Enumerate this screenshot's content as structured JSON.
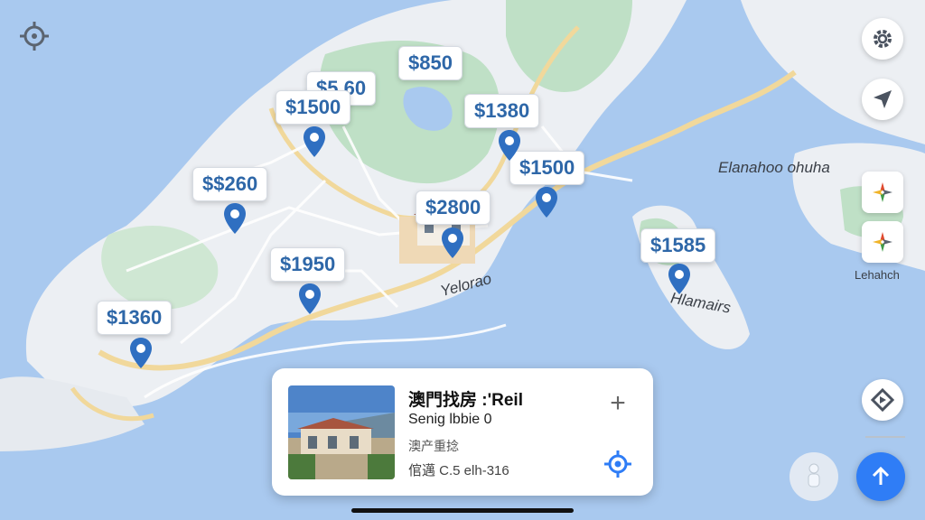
{
  "price_tags": [
    {
      "label": "$850"
    },
    {
      "label": "$5.60"
    },
    {
      "label": "$1500"
    },
    {
      "label": "$1380"
    },
    {
      "label": "$1500"
    },
    {
      "label": "$$260"
    },
    {
      "label": "$2800"
    },
    {
      "label": "$1585"
    },
    {
      "label": "$1950"
    },
    {
      "label": "$1360"
    }
  ],
  "map_labels": {
    "district_east": "Elanahoo ohuha",
    "district_center": "Yelorao",
    "island": "Hlamairs",
    "side_label": "Lehahch"
  },
  "listing_card": {
    "title": "澳門找房 :'Reil",
    "subtitle": "Senig lbbie 0",
    "category": "澳产重捻",
    "detail": "倌邁 C.5 elh-316"
  },
  "icons": {
    "top_left": "locate-target-icon",
    "settings": "gear-icon",
    "navigate": "navigation-arrow-icon",
    "compass_1": "compass-icon",
    "compass_2": "compass-icon",
    "layers": "navigation-diamond-icon",
    "person": "person-icon",
    "upload": "arrow-up-icon",
    "add": "plus-icon",
    "card_locate": "location-target-icon"
  },
  "colors": {
    "water": "#a9c9ef",
    "land": "#eceff3",
    "park": "#bfe0c6",
    "road": "#f5e5bd",
    "price_text": "#2e67a8",
    "pin": "#2f6fc1",
    "accent": "#2f7df6"
  }
}
